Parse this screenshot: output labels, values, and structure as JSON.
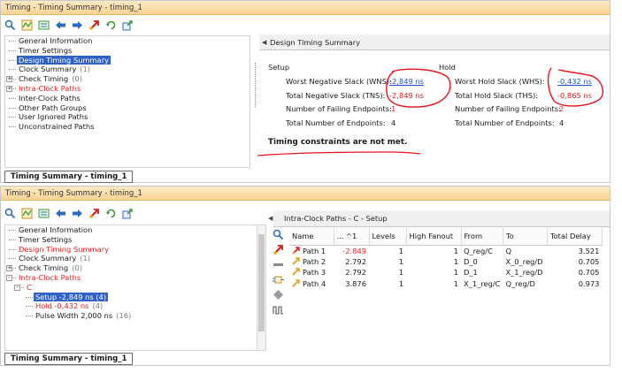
{
  "panel1": {
    "title": "Timing - Timing Summary - timing_1",
    "tree": [
      {
        "label": "General Information",
        "count": "",
        "red": false,
        "selected": false
      },
      {
        "label": "Timer Settings",
        "count": "",
        "red": false,
        "selected": false
      },
      {
        "label": "Design Timing Summary",
        "count": "",
        "red": false,
        "selected": true
      },
      {
        "label": "Clock Summary",
        "count": "(1)",
        "red": false,
        "selected": false
      },
      {
        "label": "Check Timing",
        "count": "(0)",
        "red": false,
        "selected": false
      },
      {
        "label": "Intra-Clock Paths",
        "count": "",
        "red": true,
        "selected": false
      },
      {
        "label": "Inter-Clock Paths",
        "count": "",
        "red": false,
        "selected": false
      },
      {
        "label": "Other Path Groups",
        "count": "",
        "red": false,
        "selected": false
      },
      {
        "label": "User Ignored Paths",
        "count": "",
        "red": false,
        "selected": false
      },
      {
        "label": "Unconstrained Paths",
        "count": "",
        "red": false,
        "selected": false
      }
    ],
    "bottom_tab": "Timing Summary - timing_1",
    "content_title": "Design Timing Summary",
    "setup": {
      "label": "Setup",
      "wns_label": "Worst Negative Slack (WNS):",
      "wns": "-2,849 ns",
      "tns_label": "Total Negative Slack (TNS):",
      "tns": "-2,849 ns",
      "failing_label": "Number of Failing Endpoints:",
      "failing": "1",
      "total_label": "Total Number of Endpoints:",
      "total": "4"
    },
    "hold": {
      "label": "Hold",
      "whs_label": "Worst Hold Slack (WHS):",
      "whs": "-0,432 ns",
      "ths_label": "Total Hold Slack (THS):",
      "ths": "-0,865 ns",
      "failing_label": "Number of Failing Endpoints:",
      "failing": "2",
      "total_label": "Total Number of Endpoints:",
      "total": "4"
    },
    "status_message": "Timing constraints are not met."
  },
  "panel2": {
    "title": "Timing - Timing Summary - timing_1",
    "tree": [
      {
        "label": "General Information",
        "count": "",
        "red": false,
        "selected": false
      },
      {
        "label": "Timer Settings",
        "count": "",
        "red": false,
        "selected": false
      },
      {
        "label": "Design Timing Summary",
        "count": "",
        "red": true,
        "selected": false
      },
      {
        "label": "Clock Summary",
        "count": "(1)",
        "red": false,
        "selected": false
      },
      {
        "label": "Check Timing",
        "count": "(0)",
        "red": false,
        "selected": false
      },
      {
        "label": "Intra-Clock Paths",
        "count": "",
        "red": true,
        "selected": false
      },
      {
        "label": "C",
        "count": "",
        "red": true,
        "selected": false
      },
      {
        "label": "Setup -2,849 ns (4)",
        "count": "",
        "red": true,
        "selected": true
      },
      {
        "label": "Hold -0,432 ns",
        "count": "(4)",
        "red": true,
        "selected": false
      },
      {
        "label": "Pulse Width 2,000 ns",
        "count": "(16)",
        "red": false,
        "selected": false
      }
    ],
    "bottom_tab": "Timing Summary - timing_1",
    "content_title": "Intra-Clock Paths - C - Setup",
    "columns": [
      "Name",
      "... ^1",
      "Levels",
      "High Fanout",
      "From",
      "To",
      "Total Delay"
    ],
    "rows": [
      {
        "name": "Path 1",
        "slack": "-2.849",
        "levels": "1",
        "fanout": "1",
        "from": "Q_reg/C",
        "to": "Q",
        "delay": "3.521",
        "failing": true
      },
      {
        "name": "Path 2",
        "slack": "2.792",
        "levels": "1",
        "fanout": "1",
        "from": "D_0",
        "to": "X_0_reg/D",
        "delay": "0.705",
        "failing": false
      },
      {
        "name": "Path 3",
        "slack": "2.792",
        "levels": "1",
        "fanout": "1",
        "from": "D_1",
        "to": "X_1_reg/D",
        "delay": "0.705",
        "failing": false
      },
      {
        "name": "Path 4",
        "slack": "3.876",
        "levels": "1",
        "fanout": "1",
        "from": "X_1_reg/C",
        "to": "Q_reg/D",
        "delay": "0.973",
        "failing": false
      }
    ]
  },
  "colors": {
    "title_bar": "#f8d494",
    "selection": "#2f62c7",
    "error_red": "#e02020",
    "link_blue": "#1a56cf",
    "annotation_red": "#e8141c"
  },
  "icons": [
    "search-icon",
    "timing-report-icon",
    "compare-icon",
    "back-arrow-icon",
    "forward-arrow-icon",
    "red-path-icon",
    "refresh-icon",
    "export-icon"
  ]
}
